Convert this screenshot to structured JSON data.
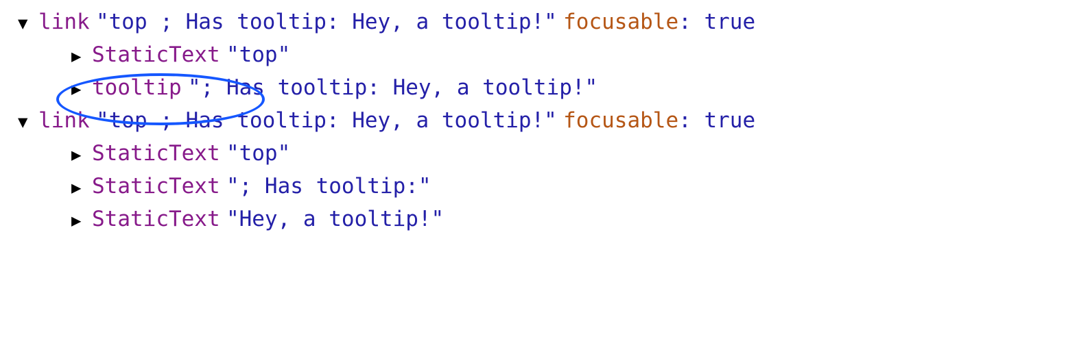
{
  "nodes": {
    "link1": {
      "role": "link",
      "name": "\"top ; Has tooltip: Hey, a tooltip!\"",
      "attrKey": "focusable",
      "attrVal": ": true"
    },
    "link1_child1": {
      "role": "StaticText",
      "name": "\"top\""
    },
    "link1_child2": {
      "role": "tooltip",
      "name": "\"; Has tooltip: Hey, a tooltip!\""
    },
    "link2": {
      "role": "link",
      "name": "\"top ; Has tooltip: Hey, a tooltip!\"",
      "attrKey": "focusable",
      "attrVal": ": true"
    },
    "link2_child1": {
      "role": "StaticText",
      "name": "\"top\""
    },
    "link2_child2": {
      "role": "StaticText",
      "name": "\"; Has tooltip:\""
    },
    "link2_child3": {
      "role": "StaticText",
      "name": "\"Hey, a tooltip!\""
    }
  }
}
